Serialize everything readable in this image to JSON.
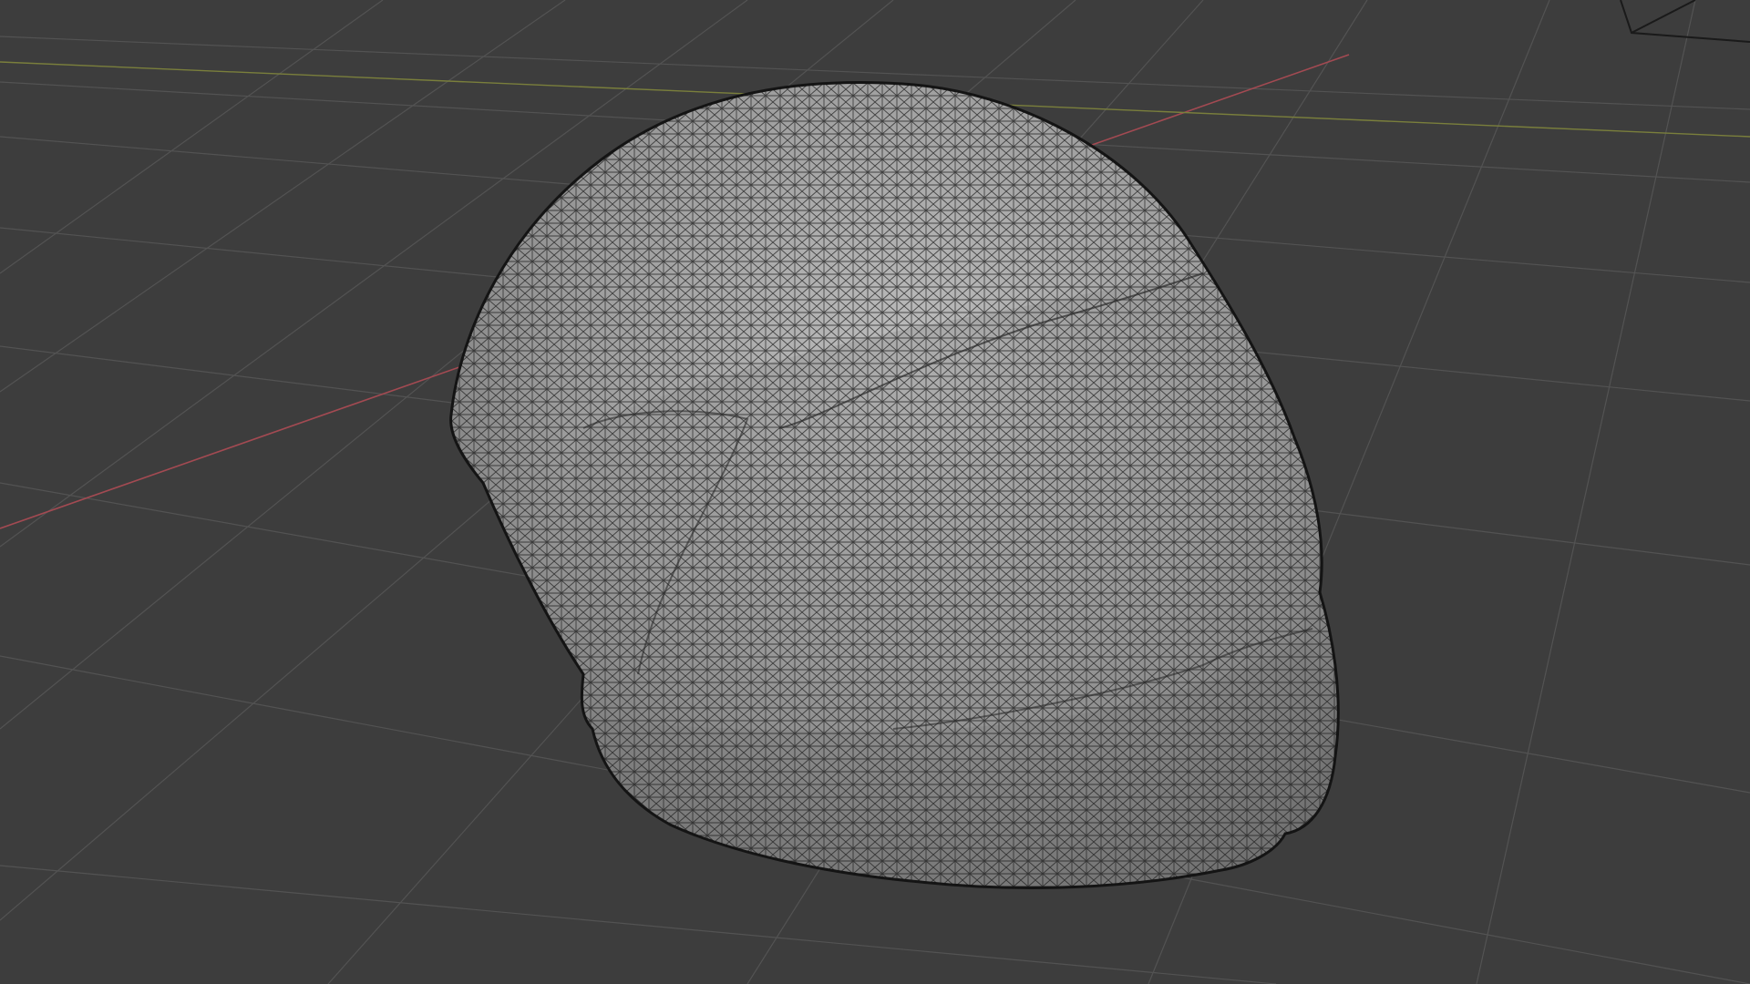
{
  "viewport": {
    "background_color": "#3d3d3d",
    "grid_color": "#535353",
    "x_axis_color": "#a34a52",
    "y_axis_color": "#7a7f3c",
    "object": {
      "shading": "solid-with-wireframe",
      "surface_color": "#9c9c9c",
      "highlight_color": "#bdbdbd",
      "shadow_color": "#6d6d6d",
      "wire_color": "#1f1f1f"
    }
  }
}
